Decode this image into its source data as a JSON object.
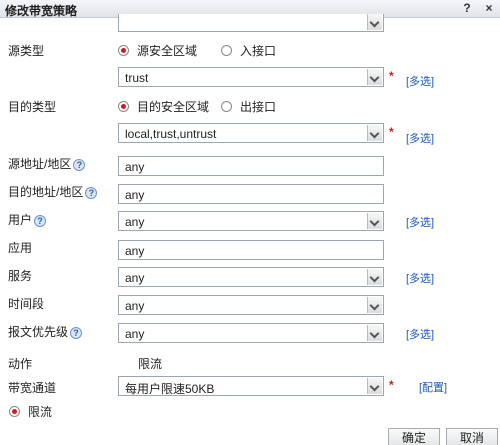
{
  "dialog": {
    "title": "修改带宽策略",
    "help_label": "?",
    "close_label": "×"
  },
  "source_type": {
    "label": "源类型",
    "options": [
      {
        "label": "源安全区域",
        "selected": true
      },
      {
        "label": "入接口",
        "selected": false
      }
    ],
    "select_value": "trust",
    "multi_label": "[多选]"
  },
  "dest_type": {
    "label": "目的类型",
    "options": [
      {
        "label": "目的安全区域",
        "selected": true
      },
      {
        "label": "出接口",
        "selected": false
      }
    ],
    "select_value": "local,trust,untrust",
    "multi_label": "[多选]"
  },
  "source_addr": {
    "label": "源地址/地区",
    "help": "?",
    "value": "any"
  },
  "dest_addr": {
    "label": "目的地址/地区",
    "help": "?",
    "value": "any"
  },
  "user": {
    "label": "用户",
    "help": "?",
    "value": "any",
    "multi_label": "[多选]"
  },
  "application": {
    "label": "应用",
    "value": "any"
  },
  "service": {
    "label": "服务",
    "value": "any",
    "multi_label": "[多选]"
  },
  "time_range": {
    "label": "时间段",
    "value": "any"
  },
  "priority": {
    "label": "报文优先级",
    "help": "?",
    "value": "any",
    "multi_label": "[多选]"
  },
  "action": {
    "label": "动作",
    "value": "限流"
  },
  "channel": {
    "label": "带宽通道",
    "value": "每用户限速50KB",
    "config_label": "[配置]"
  },
  "limit_option": {
    "label": "限流",
    "selected": true
  },
  "footer": {
    "ok_label": "确定",
    "cancel_label": "取消"
  },
  "required_mark": "*"
}
